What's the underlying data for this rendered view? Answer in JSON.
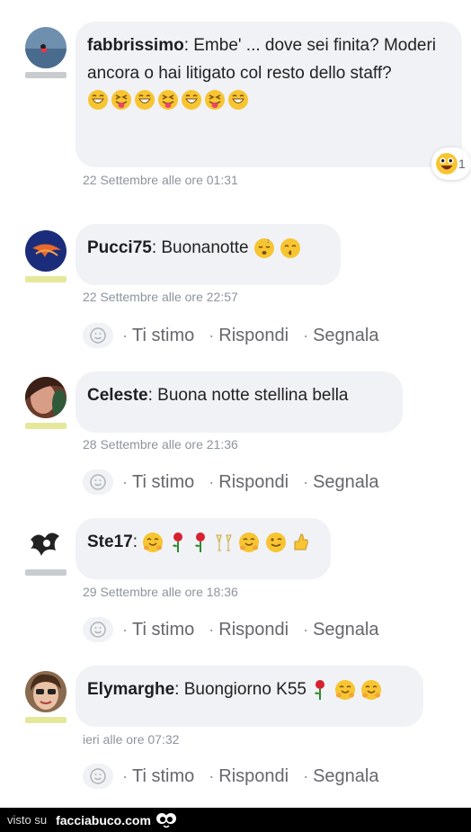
{
  "comments": [
    {
      "author": "fabbrissimo",
      "text": ": Embe' ... dove sei finita? Moderi ancora o hai litigato col resto dello staff?",
      "emojis": [
        "grin",
        "tongue",
        "grin",
        "tongue",
        "grin",
        "tongue",
        "grin"
      ],
      "timestamp": "22 Settembre alle ore 01:31",
      "reaction_count": "1"
    },
    {
      "author": "Pucci75",
      "text": ": Buonanotte",
      "timestamp": "22 Settembre alle ore 22:57"
    },
    {
      "author": "Celeste",
      "text": ": Buona notte stellina bella",
      "timestamp": "28 Settembre alle ore 21:36"
    },
    {
      "author": "Ste17",
      "text": ":",
      "timestamp": "29 Settembre alle ore 18:36"
    },
    {
      "author": "Elymarghe",
      "text": ": Buongiorno K55",
      "timestamp": "ieri alle ore 07:32"
    }
  ],
  "actions": {
    "like": "Ti stimo",
    "reply": "Rispondi",
    "report": "Segnala",
    "separator": "·"
  },
  "level_colors": {
    "gray": "#c9cccf",
    "yellow": "#e5e89a"
  },
  "footer": {
    "visto": "visto su",
    "site": "facciabuco.com"
  }
}
